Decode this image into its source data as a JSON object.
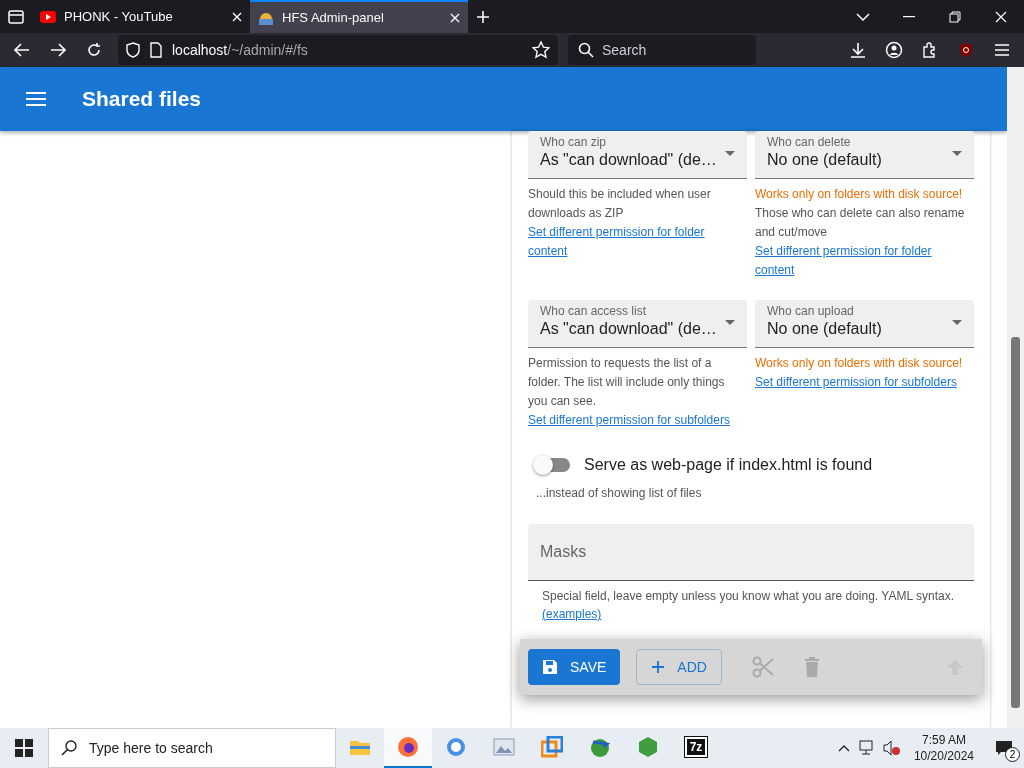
{
  "browser": {
    "tabs": [
      {
        "title": "PHONK - YouTube",
        "kind": "video",
        "selected": false
      },
      {
        "title": "HFS Admin-panel",
        "kind": "app",
        "selected": true
      }
    ],
    "address": {
      "host": "localhost",
      "path": "/~/admin/#/fs"
    },
    "search": {
      "placeholder": "Search"
    }
  },
  "app_bar": {
    "title": "Shared files"
  },
  "permissions": [
    {
      "label": "Who can zip",
      "value": "As \"can download\" (de…",
      "notes": [
        {
          "kind": "hint",
          "text": "Should this be included when user downloads as ZIP"
        },
        {
          "kind": "link",
          "text": "Set different permission for folder content"
        }
      ]
    },
    {
      "label": "Who can delete",
      "value": "No one (default)",
      "notes": [
        {
          "kind": "warning",
          "text": "Works only on folders with disk source!"
        },
        {
          "kind": "hint",
          "text": "Those who can delete can also rename and cut/move"
        },
        {
          "kind": "link",
          "text": "Set different permission for folder content"
        }
      ]
    },
    {
      "label": "Who can access list",
      "value": "As \"can download\" (de…",
      "notes": [
        {
          "kind": "hint",
          "text": "Permission to requests the list of a folder. The list will include only things you can see."
        },
        {
          "kind": "link",
          "text": "Set different permission for subfolders"
        }
      ]
    },
    {
      "label": "Who can upload",
      "value": "No one (default)",
      "notes": [
        {
          "kind": "warning",
          "text": "Works only on folders with disk source!"
        },
        {
          "kind": "link",
          "text": "Set different permission for subfolders"
        }
      ]
    }
  ],
  "toggle": {
    "label": "Serve as web-page if index.html is found",
    "on": false,
    "hint": "...instead of showing list of files"
  },
  "masks": {
    "placeholder": "Masks",
    "hint": "Special field, leave empty unless you know what you are doing. YAML syntax.",
    "link": "(examples)"
  },
  "toolbar": [
    {
      "kind": "save",
      "label": "SAVE",
      "disabled": false
    },
    {
      "kind": "add",
      "label": "ADD",
      "disabled": false
    },
    {
      "kind": "cut",
      "disabled": true
    },
    {
      "kind": "delete",
      "disabled": true
    },
    {
      "kind": "up",
      "disabled": true
    }
  ],
  "taskbar": {
    "search_placeholder": "Type here to search",
    "archiver_label": "7z",
    "time": "7:59 AM",
    "date": "10/20/2024",
    "notifications": "2"
  }
}
